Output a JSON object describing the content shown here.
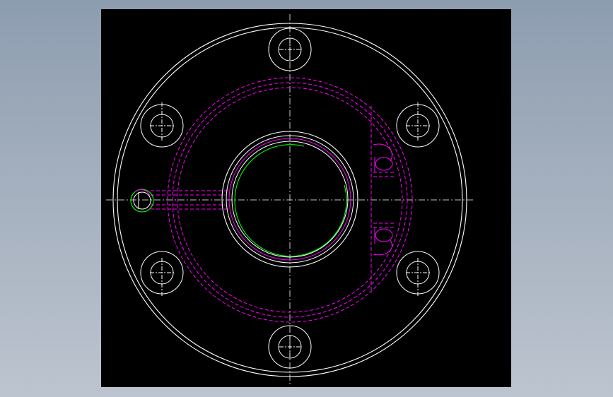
{
  "viewport": {
    "background": "#000000",
    "page_background_top": "#8d9db0",
    "page_background_bottom": "#bcc4cf"
  },
  "colors": {
    "outline": "#ffffff",
    "hidden_lines": "#ff00ff",
    "bore_arc": "#00ff00",
    "centerline": "#ffffff"
  },
  "drawing": {
    "type": "flange-top-view",
    "bolt_hole_count": 6,
    "slot_count": 2,
    "has_side_port": true
  }
}
